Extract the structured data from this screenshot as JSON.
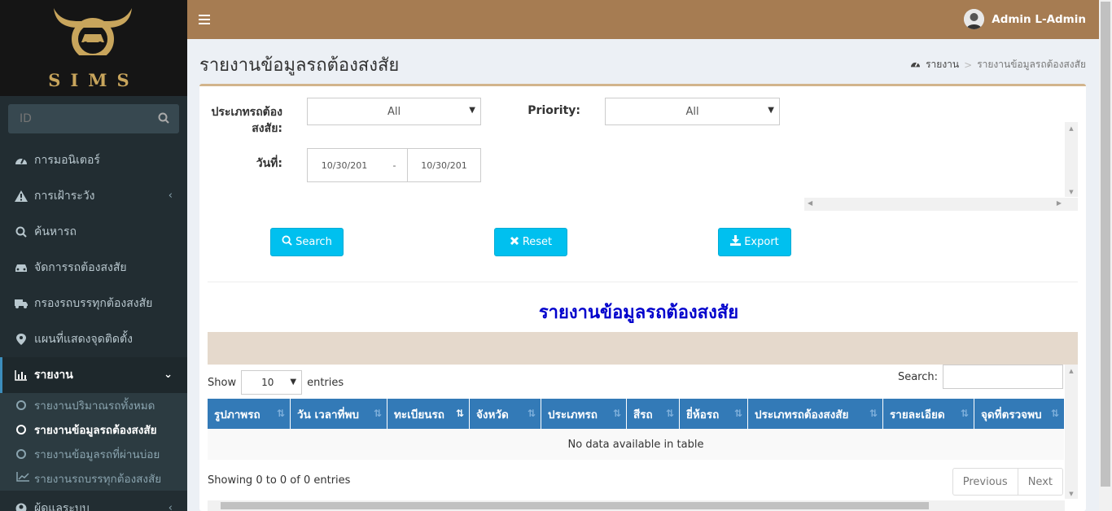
{
  "brand": {
    "name": "SIMS"
  },
  "sidebar": {
    "search_placeholder": "ID",
    "items": [
      {
        "label": "การมอนิเตอร์",
        "icon": "dashboard-icon"
      },
      {
        "label": "การเฝ้าระวัง",
        "icon": "warning-icon"
      },
      {
        "label": "ค้นหารถ",
        "icon": "search-icon"
      },
      {
        "label": "จัดการรถต้องสงสัย",
        "icon": "car-icon"
      },
      {
        "label": "กรองรถบรรทุกต้องสงสัย",
        "icon": "truck-icon"
      },
      {
        "label": "แผนที่แสดงจุดติดตั้ง",
        "icon": "map-marker-icon"
      },
      {
        "label": "รายงาน",
        "icon": "bar-chart-icon"
      }
    ],
    "report_sub": [
      {
        "label": "รายงานปริมาณรถทั้งหมด"
      },
      {
        "label": "รายงานข้อมูลรถต้องสงสัย"
      },
      {
        "label": "รายงานข้อมูลรถที่ผ่านบ่อย"
      },
      {
        "label": "รายงานรถบรรทุกต้องสงสัย"
      }
    ],
    "bottom_item": "ผู้ดูแลระบบ"
  },
  "header": {
    "user": "Admin L-Admin"
  },
  "page": {
    "title": "รายงานข้อมูลรถต้องสงสัย",
    "breadcrumb": [
      "รายงาน",
      "รายงานข้อมูลรถต้องสงสัย"
    ]
  },
  "filters": {
    "type_label_1": "ประเภทรถต้อง",
    "type_label_2": "สงสัย:",
    "type_value": "All",
    "priority_label": "Priority:",
    "priority_value": "All",
    "date_label": "วันที่:",
    "date_from": "10/30/201",
    "date_sep": "-",
    "date_to": "10/30/201"
  },
  "buttons": {
    "search": "Search",
    "reset": "Reset",
    "export": "Export"
  },
  "report": {
    "heading": "รายงานข้อมูลรถต้องสงสัย"
  },
  "table": {
    "show_label": "Show",
    "entries_value": "10",
    "entries_label": "entries",
    "search_label": "Search:",
    "columns": [
      "รูปภาพรถ",
      "วัน เวลาที่พบ",
      "ทะเบียนรถ",
      "จังหวัด",
      "ประเภทรถ",
      "สีรถ",
      "ยี่ห้อรถ",
      "ประเภทรถต้องสงสัย",
      "รายละเอียด",
      "จุดที่ตรวจพบ"
    ],
    "empty": "No data available in table",
    "info": "Showing 0 to 0 of 0 entries",
    "prev": "Previous",
    "next": "Next"
  },
  "colors": {
    "header": "#a67c52",
    "sidebar": "#222d32",
    "accent_button": "#00c0ef",
    "table_head": "#337ab7",
    "report_title": "#0000cc"
  }
}
